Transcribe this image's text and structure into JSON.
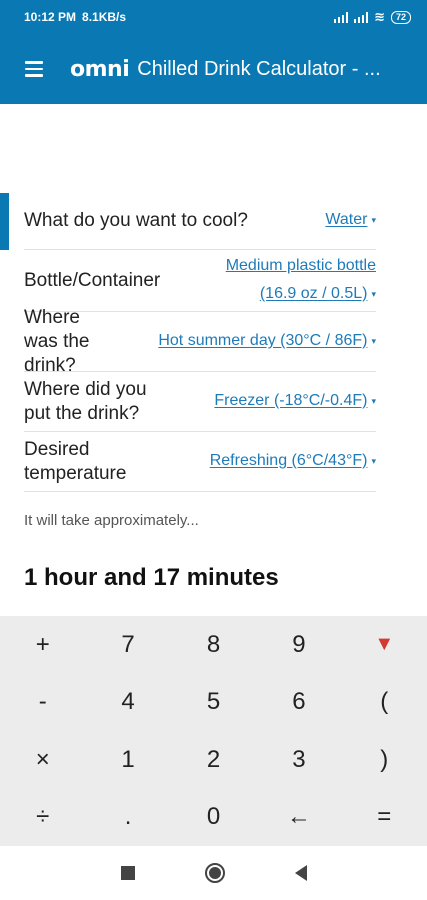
{
  "status": {
    "time": "10:12 PM",
    "speed": "8.1KB/s",
    "battery": "72",
    "icons": [
      "signal-icon",
      "signal-icon",
      "wifi-icon",
      "battery-icon"
    ]
  },
  "app_bar": {
    "menu_icon": "hamburger-menu-icon",
    "logo": "omni",
    "title": "Chilled Drink Calculator - ..."
  },
  "form": {
    "rows": [
      {
        "label": "What do you want to cool?",
        "value": "Water"
      },
      {
        "label": "Bottle/Container",
        "value_line1": "Medium plastic bottle",
        "value_line2": "(16.9 oz / 0.5L)"
      },
      {
        "label": "Where was the drink?",
        "value": "Hot summer day (30°C / 86F)"
      },
      {
        "label": "Where did you put the drink?",
        "value": "Freezer (-18°C/-0.4F)"
      },
      {
        "label": "Desired temperature",
        "value": "Refreshing (6°C/43°F)"
      }
    ],
    "caret": "▾"
  },
  "result": {
    "prefix": "It will take approximately...",
    "value": "1 hour and 17 minutes"
  },
  "keypad": {
    "keys": [
      "+",
      "7",
      "8",
      "9",
      "▼",
      "-",
      "4",
      "5",
      "6",
      "(",
      "×",
      "1",
      "2",
      "3",
      ")",
      "÷",
      ".",
      "0",
      "←",
      "="
    ]
  },
  "nav": {
    "icons": [
      "recents-square-icon",
      "home-circle-icon",
      "back-triangle-icon"
    ]
  },
  "colors": {
    "brand": "#0a78b3",
    "link": "#1f7bb8",
    "keypad_bg": "#ececec",
    "accent_red": "#d03a2f"
  }
}
